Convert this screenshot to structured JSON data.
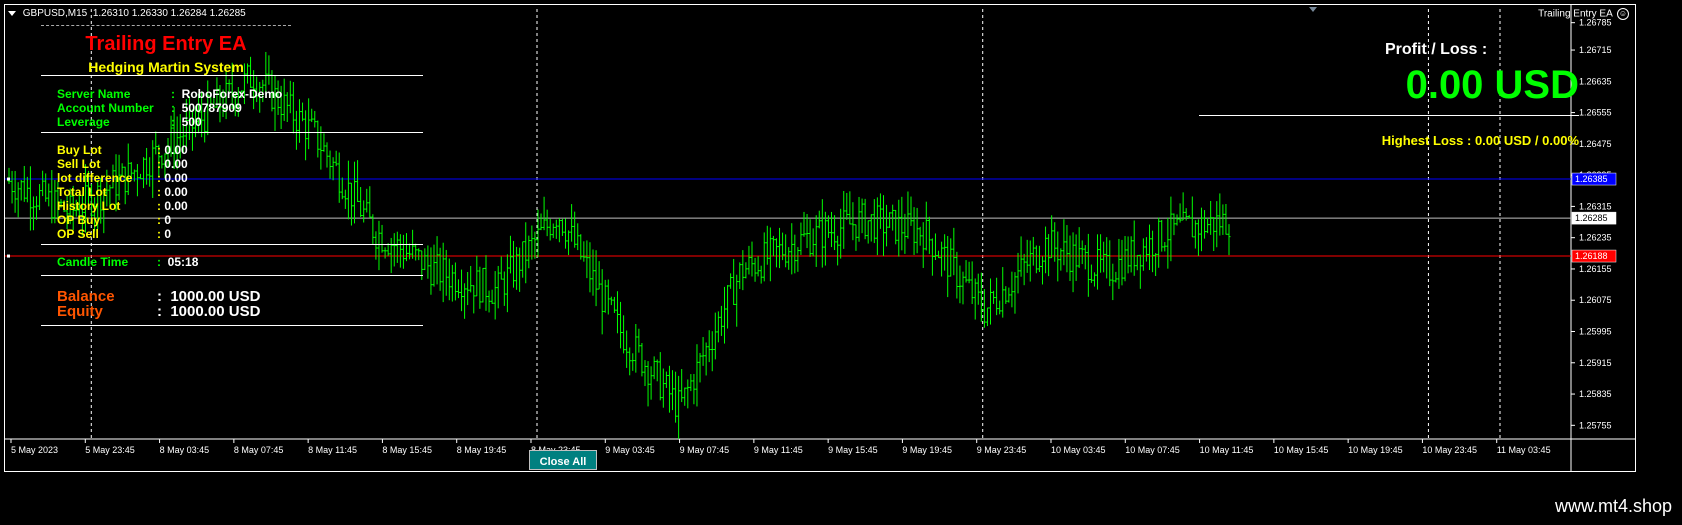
{
  "symbol": {
    "label": "GBPUSD,M15",
    "ohlc": "1.26310 1.26330 1.26284 1.26285"
  },
  "ea_name": "Trailing Entry EA",
  "panel": {
    "title": "Trailing Entry EA",
    "subtitle": "Hedging Martin System",
    "account": [
      {
        "key": "Server Name",
        "value": "RoboForex-Demo"
      },
      {
        "key": "Account Number",
        "value": "500787909"
      },
      {
        "key": "Leverage",
        "value": "500"
      }
    ],
    "lots": [
      {
        "key": "Buy  Lot",
        "value": "0.00"
      },
      {
        "key": "Sell Lot",
        "value": "0.00"
      },
      {
        "key": "lot difference",
        "value": "0.00"
      },
      {
        "key": "Total Lot",
        "value": "0.00"
      },
      {
        "key": "History Lot",
        "value": "0.00"
      },
      {
        "key": "OP Buy",
        "value": "0"
      },
      {
        "key": "OP Sell",
        "value": "0"
      }
    ],
    "candle_time": {
      "key": "Candle Time",
      "value": "05:18"
    },
    "balance": {
      "key": "Balance",
      "value": "1000.00 USD"
    },
    "equity": {
      "key": "Equity",
      "value": "1000.00 USD"
    },
    "separator": ":"
  },
  "profit_loss": {
    "label": "Profit / Loss :",
    "value": "0.00 USD",
    "highest_loss": "Highest Loss  : 0.00 USD / 0.00%"
  },
  "close_button": "Close All",
  "price_axis": {
    "ticks": [
      "1.26785",
      "1.26715",
      "1.26635",
      "1.26555",
      "1.26475",
      "1.26395",
      "1.26315",
      "1.26235",
      "1.26155",
      "1.26075",
      "1.25995",
      "1.25915",
      "1.25835",
      "1.25755"
    ],
    "current_price": "1.26285",
    "blue_line_price": "1.26385",
    "red_line_price": "1.26188"
  },
  "time_axis": [
    "5 May 2023",
    "5 May 23:45",
    "8 May 03:45",
    "8 May 07:45",
    "8 May 11:45",
    "8 May 15:45",
    "8 May 19:45",
    "8 May 23:45",
    "9 May 03:45",
    "9 May 07:45",
    "9 May 11:45",
    "9 May 15:45",
    "9 May 19:45",
    "9 May 23:45",
    "10 May 03:45",
    "10 May 07:45",
    "10 May 11:45",
    "10 May 15:45",
    "10 May 19:45",
    "10 May 23:45",
    "11 May 03:45"
  ],
  "chart_data": {
    "type": "line",
    "title": "",
    "xlabel": "",
    "ylabel": "",
    "ylim": [
      1.2572,
      1.2682
    ],
    "x": [
      "5 May 2023",
      "5 May 23:45",
      "8 May 03:45",
      "8 May 07:45",
      "8 May 11:45",
      "8 May 15:45",
      "8 May 19:45",
      "8 May 23:45",
      "9 May 03:45",
      "9 May 07:45",
      "9 May 11:45",
      "9 May 15:45",
      "9 May 19:45",
      "9 May 23:45",
      "10 May 03:45",
      "10 May 07:45",
      "10 May 11:45",
      "10 May 15:45",
      "10 May 19:45",
      "10 May 23:45",
      "11 May 03:45"
    ],
    "series": [
      {
        "values": [
          1.2638,
          1.263,
          1.264,
          1.2652,
          1.2665,
          1.265,
          1.2625,
          1.2615,
          1.261,
          1.263,
          1.26,
          1.258,
          1.2615,
          1.2623,
          1.2628,
          1.2625,
          1.2605,
          1.2622,
          1.2615,
          1.2625,
          1.2628
        ]
      }
    ],
    "horizontal_lines": [
      {
        "price": 1.26385,
        "color": "#0000ff"
      },
      {
        "price": 1.26285,
        "color": "#c0c0c0"
      },
      {
        "price": 1.26188,
        "color": "#ff0000"
      }
    ],
    "up_color": "#00ff00",
    "grid": false
  },
  "colors": {
    "bars": "#00ff00",
    "background": "#000000",
    "title": "#ff0000",
    "subtitle": "#ffff00",
    "account_text": "#00ff00",
    "lots_text": "#ffff00",
    "balance_key": "#ff5500",
    "button": "#008080"
  },
  "watermark": "www.mt4.shop"
}
